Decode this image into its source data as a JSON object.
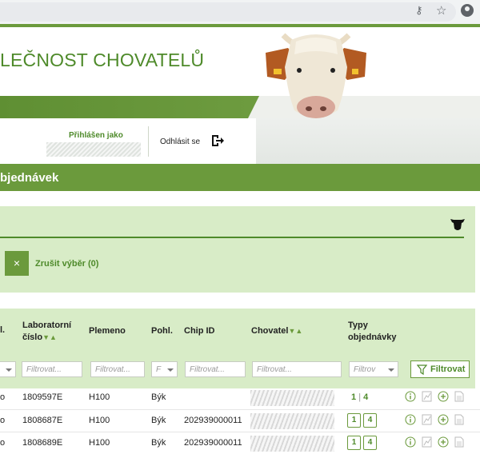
{
  "browser": {
    "icons": [
      "key-icon",
      "star-icon",
      "account-icon"
    ]
  },
  "header": {
    "title": "LEČNOST CHOVATELŮ",
    "logged_in_label": "Přihlášen jako",
    "logout_label": "Odhlásit se"
  },
  "section": {
    "title": "bjednávek"
  },
  "filter_panel": {
    "clear_label": "Zrušit výběr (0)",
    "clear_icon": "×"
  },
  "table": {
    "columns": {
      "c0": "l.",
      "lab_line1": "Laboratorní",
      "lab_line2": "číslo",
      "breed": "Plemeno",
      "sex": "Pohl.",
      "chip": "Chip ID",
      "owner": "Chovatel",
      "types_line1": "Typy",
      "types_line2": "objednávky"
    },
    "filter_placeholder": "Filtrovat...",
    "filter_short": "F",
    "filter_types": "Filtrov",
    "filter_button": "Filtrovat",
    "rows": [
      {
        "c0": "o",
        "lab": "1809597E",
        "breed": "H100",
        "sex": "Býk",
        "chip": "",
        "type_a": "1",
        "type_sep": "|",
        "type_b": "4"
      },
      {
        "c0": "o",
        "lab": "1808687E",
        "breed": "H100",
        "sex": "Býk",
        "chip": "202939000011",
        "type_a": "1",
        "type_b": "4"
      },
      {
        "c0": "o",
        "lab": "1808689E",
        "breed": "H100",
        "sex": "Býk",
        "chip": "202939000011",
        "type_a": "1",
        "type_b": "4"
      }
    ]
  },
  "colors": {
    "brand_green": "#6b9a3c",
    "panel_green": "#d8ecc7",
    "text_green": "#4e8a2a"
  }
}
